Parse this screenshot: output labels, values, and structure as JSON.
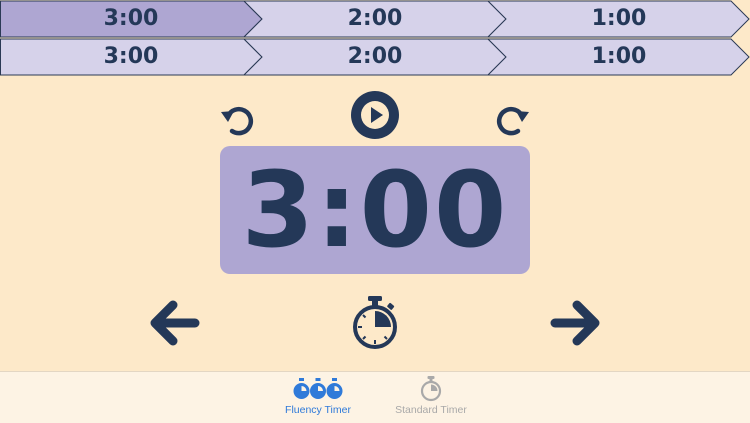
{
  "segments": {
    "row1": [
      "3:00",
      "2:00",
      "1:00"
    ],
    "row2": [
      "3:00",
      "2:00",
      "1:00"
    ]
  },
  "colors": {
    "background": "#fde9c9",
    "segment_active": "#aea6d2",
    "segment_inactive": "#d6d2ea",
    "ink": "#243858",
    "tab_active": "#2f7ad9",
    "tab_inactive": "#a9a9a9"
  },
  "controls": {
    "reset_icon": "rotate-ccw-icon",
    "play_icon": "play-icon",
    "redo_icon": "rotate-cw-icon",
    "prev_icon": "arrow-left-icon",
    "mode_icon": "stopwatch-icon",
    "next_icon": "arrow-right-icon"
  },
  "display": {
    "time": "3:00"
  },
  "tabbar": {
    "tabs": [
      {
        "label": "Fluency Timer",
        "icon": "triple-stopwatch-icon",
        "active": true
      },
      {
        "label": "Standard Timer",
        "icon": "stopwatch-icon",
        "active": false
      }
    ]
  }
}
